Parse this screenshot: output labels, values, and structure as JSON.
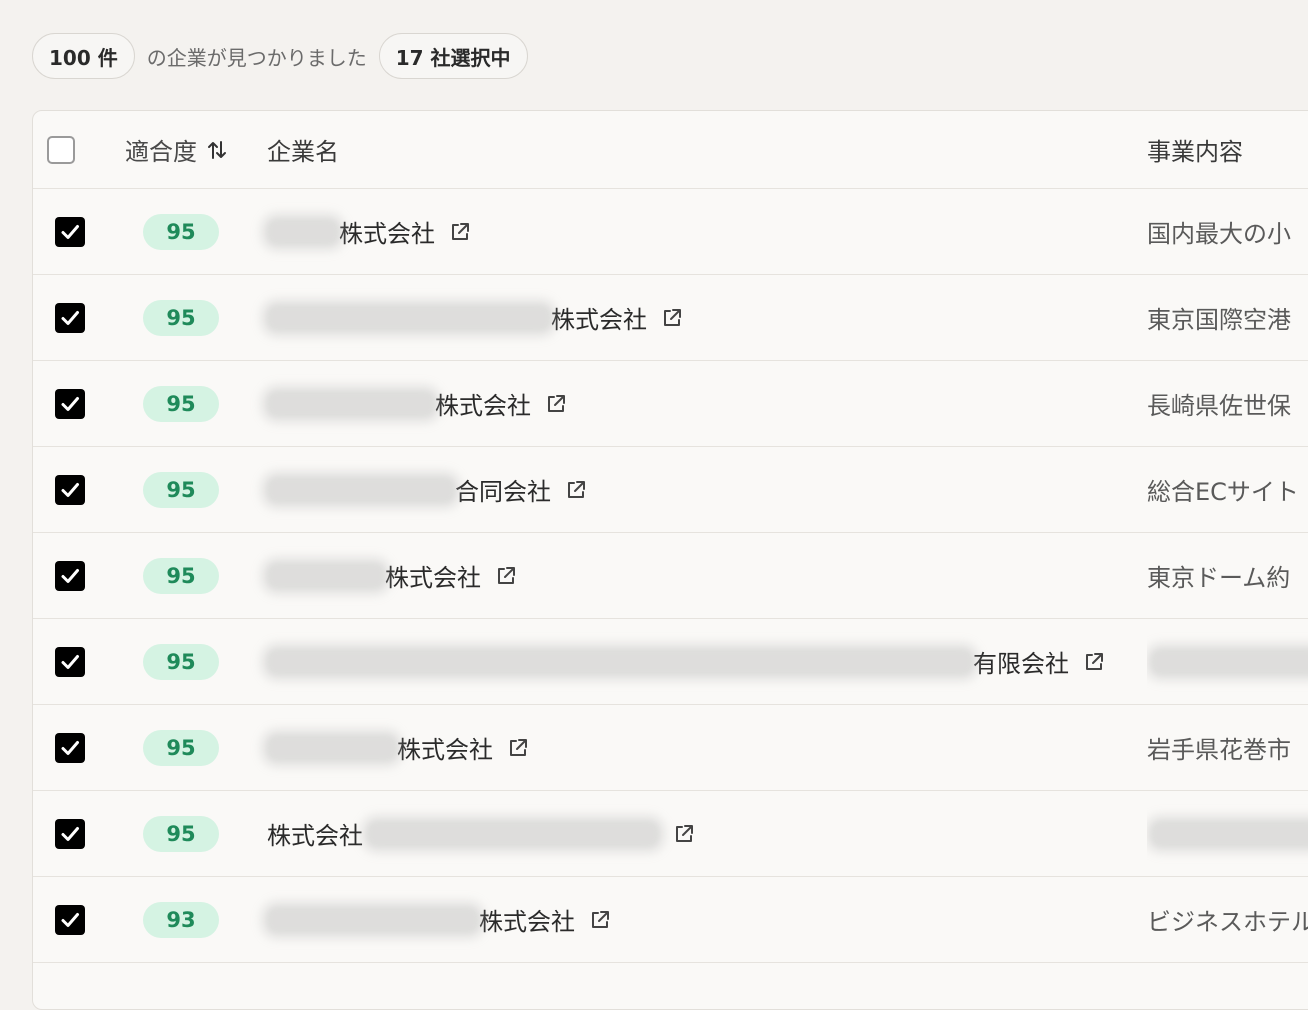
{
  "summary": {
    "count_label": "100 件",
    "found_text": "の企業が見つかりました",
    "selected_label": "17 社選択中"
  },
  "table": {
    "headers": {
      "score": "適合度",
      "name": "企業名",
      "description": "事業内容"
    },
    "rows": [
      {
        "score": "95",
        "name_suffix": "株式会社",
        "description": "国内最大の小",
        "checked": true
      },
      {
        "score": "95",
        "name_suffix": "株式会社",
        "description": "東京国際空港",
        "checked": true
      },
      {
        "score": "95",
        "name_suffix": "株式会社",
        "description": "長崎県佐世保",
        "checked": true
      },
      {
        "score": "95",
        "name_suffix": "合同会社",
        "description": "総合ECサイト",
        "checked": true
      },
      {
        "score": "95",
        "name_suffix": "株式会社",
        "description": "東京ドーム約",
        "checked": true
      },
      {
        "score": "95",
        "name_suffix": "有限会社",
        "description": "",
        "checked": true
      },
      {
        "score": "95",
        "name_suffix": "株式会社",
        "description": "岩手県花巻市",
        "checked": true
      },
      {
        "score": "95",
        "name_prefix": "株式会社",
        "description": "",
        "checked": true
      },
      {
        "score": "93",
        "name_suffix": "株式会社",
        "description": "ビジネスホテル",
        "checked": true
      }
    ]
  },
  "colors": {
    "score_badge_bg": "#d5f3e3",
    "score_badge_text": "#1f8a5a",
    "checkbox_checked": "#000000"
  },
  "icons": {
    "sort": "sort-arrows-icon",
    "external_link": "external-link-icon",
    "check": "check-icon"
  }
}
